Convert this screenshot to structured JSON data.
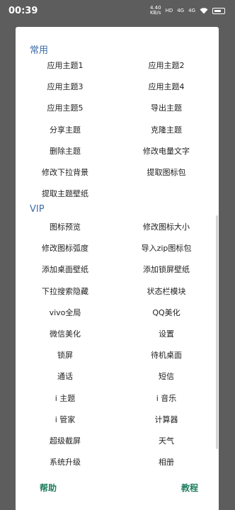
{
  "status": {
    "time": "00:39",
    "net1": "4.40",
    "net1_unit": "KB/s",
    "sig1": "HD",
    "sig2": "4G",
    "sig3": "4G",
    "battery": "39"
  },
  "sections": [
    {
      "title": "常用",
      "items": [
        "应用主题1",
        "应用主题2",
        "应用主题3",
        "应用主题4",
        "应用主题5",
        "导出主题",
        "分享主题",
        "克隆主题",
        "删除主题",
        "修改电量文字",
        "修改下拉背景",
        "提取图标包",
        "提取主题壁纸"
      ]
    },
    {
      "title": "VIP",
      "items": [
        "图标预览",
        "修改图标大小",
        "修改图标弧度",
        "导入zip图标包",
        "添加桌面壁纸",
        "添加锁屏壁纸",
        "下拉搜索隐藏",
        "状态栏模块",
        "vivo全局",
        "QQ美化",
        "微信美化",
        "设置",
        "锁屏",
        "待机桌面",
        "通话",
        "短信",
        "i 主题",
        "i 音乐",
        "i 管家",
        "计算器",
        "超级截屏",
        "天气",
        "系统升级",
        "相册"
      ]
    }
  ],
  "footer": {
    "left": "帮助",
    "right": "教程"
  }
}
